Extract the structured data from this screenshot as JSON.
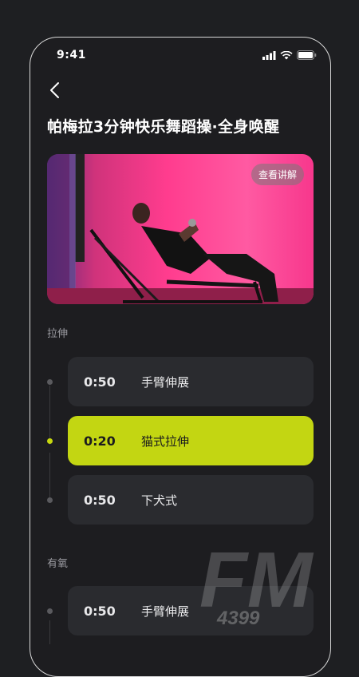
{
  "status_bar": {
    "time": "9:41"
  },
  "page": {
    "title": "帕梅拉3分钟快乐舞蹈操·全身唤醒"
  },
  "video": {
    "view_label": "查看讲解"
  },
  "sections": [
    {
      "label": "拉伸",
      "items": [
        {
          "duration": "0:50",
          "name": "手臂伸展",
          "active": false
        },
        {
          "duration": "0:20",
          "name": "猫式拉伸",
          "active": true
        },
        {
          "duration": "0:50",
          "name": "下犬式",
          "active": false
        }
      ]
    },
    {
      "label": "有氧",
      "items": [
        {
          "duration": "0:50",
          "name": "手臂伸展",
          "active": false
        }
      ]
    }
  ],
  "watermark": {
    "big": "FM",
    "small": "4399"
  },
  "colors": {
    "accent": "#c3d612",
    "background": "#1d1d20",
    "card": "#2a2b2f"
  }
}
